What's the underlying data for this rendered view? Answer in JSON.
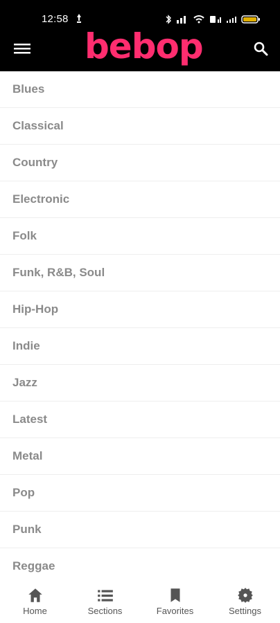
{
  "status_bar": {
    "time": "12:58",
    "battery_color": "#e2b000"
  },
  "header": {
    "brand": "bebop",
    "brand_color": "#ff2d6f",
    "menu_icon": "hamburger-menu-icon",
    "search_icon": "search-icon"
  },
  "genres": [
    "Blues",
    "Classical",
    "Country",
    "Electronic",
    "Folk",
    "Funk, R&B, Soul",
    "Hip-Hop",
    "Indie",
    "Jazz",
    "Latest",
    "Metal",
    "Pop",
    "Punk",
    "Reggae"
  ],
  "bottom_nav": {
    "home_label": "Home",
    "sections_label": "Sections",
    "favorites_label": "Favorites",
    "settings_label": "Settings"
  },
  "colors": {
    "topbar": "#000000",
    "list_text": "#8a8a8a",
    "nav_icon": "#555555"
  }
}
